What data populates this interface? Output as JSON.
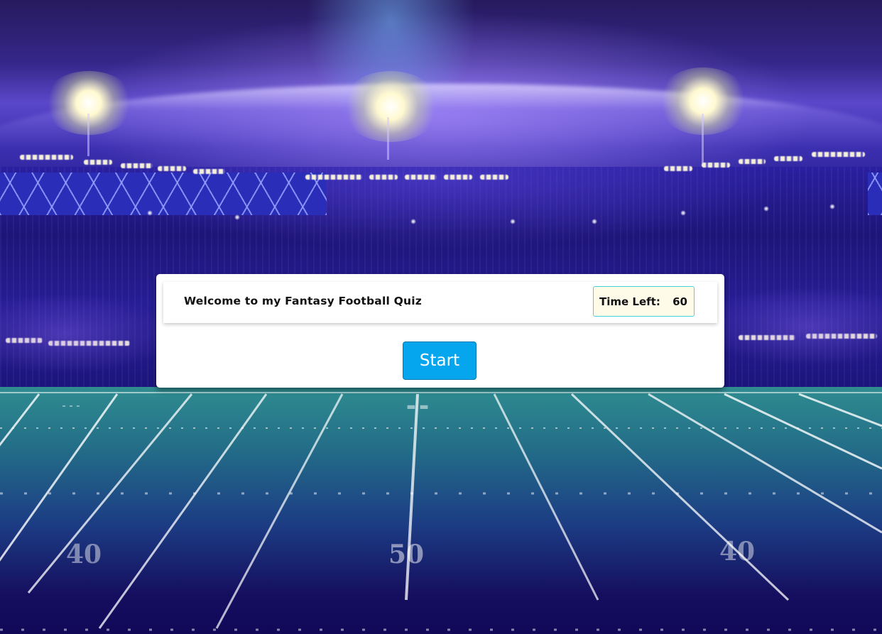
{
  "quiz": {
    "title": "Welcome to my Fantasy Football Quiz",
    "timer_label": "Time Left:",
    "timer_value": "60",
    "start_label": "Start"
  },
  "field": {
    "yard_numbers": [
      "40",
      "50",
      "40"
    ]
  },
  "colors": {
    "start_button": "#06a6ee",
    "timer_border": "#47d3dc",
    "timer_background": "#fffbe9",
    "card_background": "#ffffff"
  }
}
